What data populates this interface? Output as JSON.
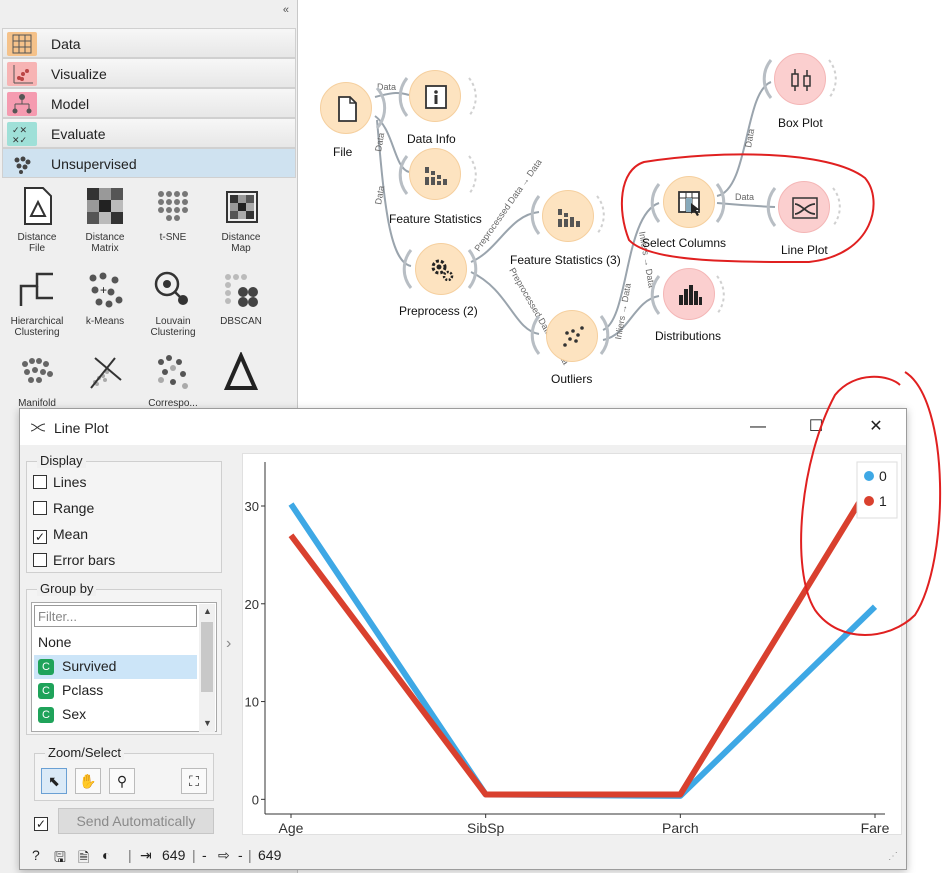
{
  "toolbox": {
    "collapse": "«",
    "categories": [
      {
        "label": "Data",
        "color": "#f5c28a"
      },
      {
        "label": "Visualize",
        "color": "#f7b4b4"
      },
      {
        "label": "Model",
        "color": "#f59bb0"
      },
      {
        "label": "Evaluate",
        "color": "#9fe0d8"
      },
      {
        "label": "Unsupervised",
        "color": "#cfe2f0"
      }
    ],
    "widgets": [
      {
        "label": "Distance\nFile"
      },
      {
        "label": "Distance\nMatrix"
      },
      {
        "label": "t-SNE"
      },
      {
        "label": "Distance\nMap"
      },
      {
        "label": "Hierarchical\nClustering"
      },
      {
        "label": "k-Means"
      },
      {
        "label": "Louvain\nClustering"
      },
      {
        "label": "DBSCAN"
      },
      {
        "label": "Manifold"
      },
      {
        "label": ""
      },
      {
        "label": "Correspo..."
      },
      {
        "label": ""
      }
    ]
  },
  "workflow": {
    "nodes": [
      {
        "id": "file",
        "label": "File",
        "color": "orange"
      },
      {
        "id": "datainfo",
        "label": "Data Info",
        "color": "orange"
      },
      {
        "id": "featstat",
        "label": "Feature Statistics",
        "color": "orange"
      },
      {
        "id": "preprocess",
        "label": "Preprocess (2)",
        "color": "orange"
      },
      {
        "id": "featstat3",
        "label": "Feature Statistics (3)",
        "color": "orange"
      },
      {
        "id": "outliers",
        "label": "Outliers",
        "color": "orange"
      },
      {
        "id": "selectcols",
        "label": "Select Columns",
        "color": "orange"
      },
      {
        "id": "boxplot",
        "label": "Box Plot",
        "color": "pink"
      },
      {
        "id": "lineplot",
        "label": "Line Plot",
        "color": "pink"
      },
      {
        "id": "distributions",
        "label": "Distributions",
        "color": "pink"
      }
    ],
    "edge_labels": {
      "data": "Data",
      "preprocessed": "Preprocessed Data → Data",
      "inliers": "Inliers → Data"
    }
  },
  "window": {
    "title": "Line Plot",
    "minimize": "—",
    "maximize": "☐",
    "close": "✕",
    "display": {
      "title": "Display",
      "options": [
        {
          "label": "Lines",
          "checked": false
        },
        {
          "label": "Range",
          "checked": false
        },
        {
          "label": "Mean",
          "checked": true
        },
        {
          "label": "Error bars",
          "checked": false
        }
      ]
    },
    "group_by": {
      "title": "Group by",
      "filter_placeholder": "Filter...",
      "items": [
        {
          "label": "None",
          "badge": ""
        },
        {
          "label": "Survived",
          "badge": "C",
          "selected": true
        },
        {
          "label": "Pclass",
          "badge": "C"
        },
        {
          "label": "Sex",
          "badge": "C"
        }
      ]
    },
    "zoom": {
      "title": "Zoom/Select"
    },
    "send_auto": {
      "label": "Send Automatically",
      "checked": true
    },
    "status": {
      "input_count": "649",
      "sep": "|",
      "dash": "-",
      "output_count": "649"
    }
  },
  "chart_data": {
    "type": "line",
    "categories": [
      "Age",
      "SibSp",
      "Parch",
      "Fare"
    ],
    "series": [
      {
        "name": "0",
        "color": "#3ea8e5",
        "values": [
          30.2,
          0.5,
          0.35,
          19.7
        ]
      },
      {
        "name": "1",
        "color": "#d9402e",
        "values": [
          27.0,
          0.5,
          0.5,
          33.0
        ]
      }
    ],
    "ylim": [
      -1.5,
      34.5
    ],
    "yticks": [
      "0",
      "10",
      "20",
      "30"
    ],
    "legend": "top-right",
    "grid": false
  }
}
